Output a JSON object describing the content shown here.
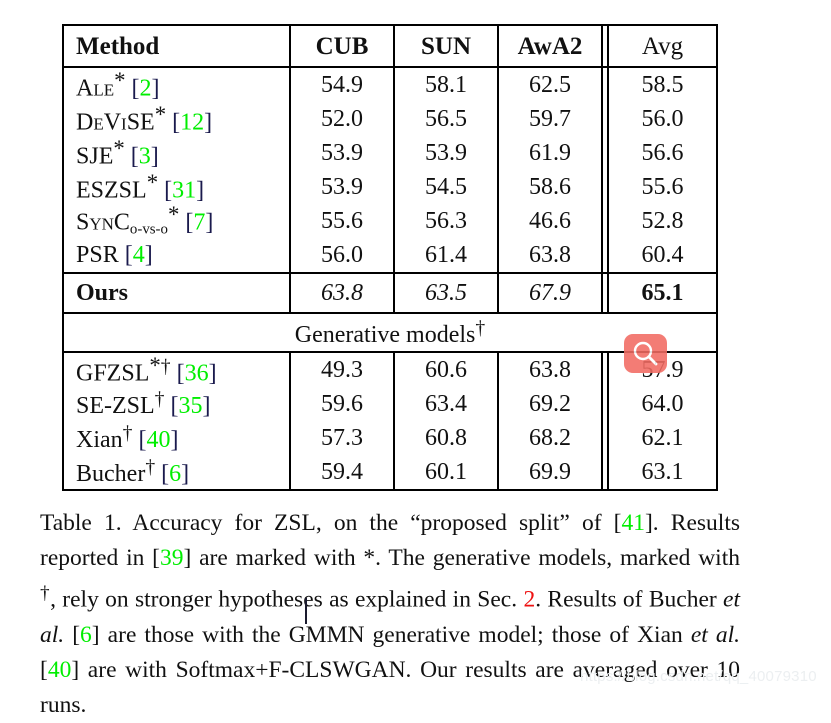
{
  "table": {
    "columns": [
      "Method",
      "CUB",
      "SUN",
      "AwA2",
      "Avg"
    ],
    "section_label": "Generative models",
    "section_label_dagger": "†",
    "rows": [
      {
        "method_main": "A",
        "method_rest": "LE",
        "suffix": "*",
        "cite": "2",
        "cub": "54.9",
        "sun": "58.1",
        "awa2": "62.5",
        "avg": "58.5"
      },
      {
        "method_main": "D",
        "method_rest": "E",
        "cap2": "V",
        "rest2": "I",
        "cap3": "SE",
        "suffix": "*",
        "cite": "12",
        "cub": "52.0",
        "sun": "56.5",
        "awa2": "59.7",
        "avg": "56.0"
      },
      {
        "method_main": "SJE",
        "suffix": "*",
        "cite": "3",
        "cub": "53.9",
        "sun": "53.9",
        "awa2": "61.9",
        "avg": "56.6"
      },
      {
        "method_main": "ESZSL",
        "suffix": "*",
        "cite": "31",
        "cub": "53.9",
        "sun": "54.5",
        "awa2": "58.6",
        "avg": "55.6"
      },
      {
        "method_main": "S",
        "method_rest": "YN",
        "cap_c": "C",
        "subscript": "o-vs-o",
        "suffix": "*",
        "cite": "7",
        "cub": "55.6",
        "sun": "56.3",
        "awa2": "46.6",
        "avg": "52.8"
      },
      {
        "method_main": "PSR",
        "cite": "4",
        "cub": "56.0",
        "sun": "61.4",
        "awa2": "63.8",
        "avg": "60.4"
      }
    ],
    "ours_row": {
      "method": "Ours",
      "cub": "63.8",
      "sun": "63.5",
      "awa2": "67.9",
      "avg": "65.1"
    },
    "gen_rows": [
      {
        "method": "GFZSL",
        "star": "*",
        "dagger": "†",
        "cite": "36",
        "cub": "49.3",
        "sun": "60.6",
        "awa2": "63.8",
        "avg": "57.9"
      },
      {
        "method": "SE-ZSL",
        "star": "",
        "dagger": "†",
        "cite": "35",
        "cub": "59.6",
        "sun": "63.4",
        "awa2": "69.2",
        "avg": "64.0"
      },
      {
        "method": "Xian",
        "star": "",
        "dagger": "†",
        "cite": "40",
        "cub": "57.3",
        "sun": "60.8",
        "awa2": "68.2",
        "avg": "62.1"
      },
      {
        "method": "Bucher",
        "star": "",
        "dagger": "†",
        "cite": "6",
        "cub": "59.4",
        "sun": "60.1",
        "awa2": "69.9",
        "avg": "63.1"
      }
    ]
  },
  "caption": {
    "label": "Table 1.",
    "p1": " Accuracy for ZSL, on the “proposed split” of [",
    "cite41": "41",
    "p2": "]. Results reported in [",
    "cite39": "39",
    "p3": "] are marked with *. The generative models, marked with ",
    "dagger": "†",
    "p4": ", rely on stronger hypotheses as explained in Sec. ",
    "sec2": "2",
    "p5": ". Results of Bucher ",
    "etal1": "et al.",
    "p6": " [",
    "cite6": "6",
    "p7": "] are those with the GMMN generative model; those of Xian ",
    "etal2": "et al.",
    "p8": " [",
    "cite40": "40",
    "p9": "] are with Softmax+F-CLSWGAN. Our results are averaged over 10 runs."
  },
  "overlays": {
    "zoom_cursor_icon": "magnifier-icon",
    "zoom_cursor_color": "#f26b62",
    "text_caret": "text-insertion-caret"
  },
  "watermark": {
    "text": "https://blog.csdn.net/qq_40079310",
    "color": "#eceff1"
  },
  "colors": {
    "citation_green": "#00ee00",
    "section_red": "#ee1111",
    "text": "#111111",
    "rule": "#000000"
  }
}
